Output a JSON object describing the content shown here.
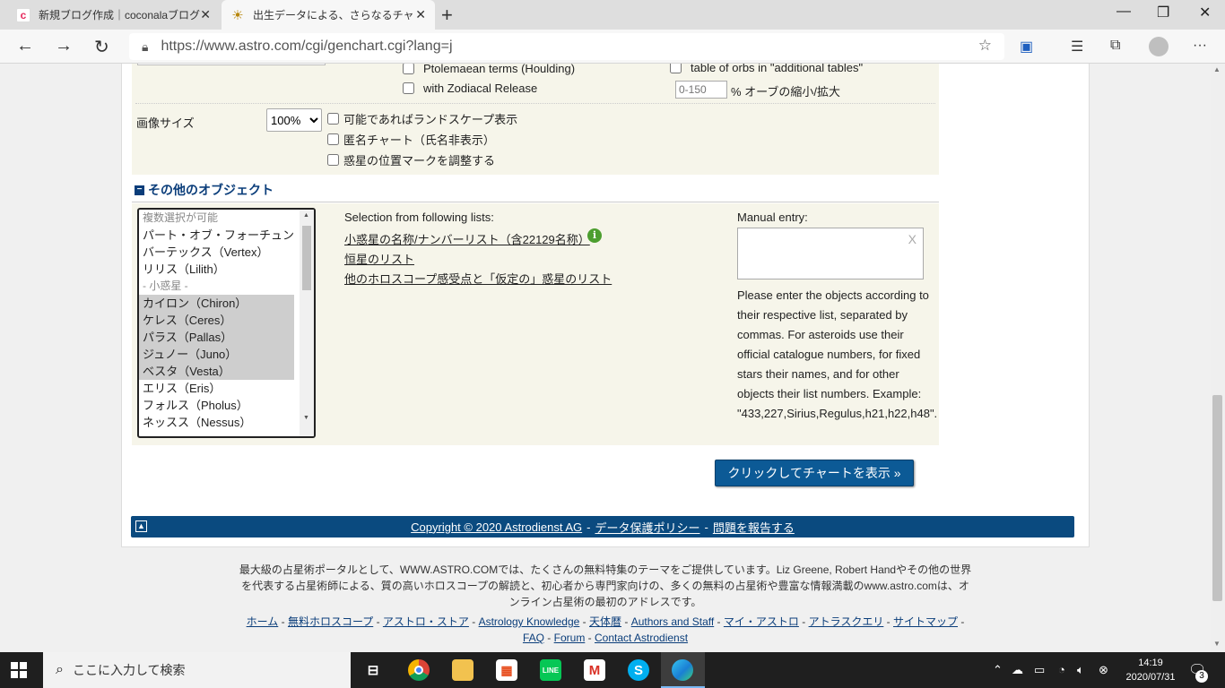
{
  "browser": {
    "tabs": [
      {
        "title": "新規ブログ作成｜coconalaブログ",
        "favicon_letter": "c"
      },
      {
        "title": "出生データによる、さらなるチャート選択",
        "favicon_glyph": "☀"
      }
    ],
    "url": "https://www.astro.com/cgi/genchart.cgi?lang=j"
  },
  "options": {
    "ptolemaean_label": "Ptolemaean terms (Houlding)",
    "zodiacal_label": "with Zodiacal Release",
    "orbs_table_label": "table of orbs in \"additional tables\"",
    "orb_placeholder": "0-150",
    "orb_suffix": "% オーブの縮小/拡大",
    "image_size_label": "画像サイズ",
    "image_size_value": "100%",
    "landscape_label": "可能であればランドスケープ表示",
    "anonymous_label": "匿名チャート（氏名非表示）",
    "adjust_marks_label": "惑星の位置マークを調整する"
  },
  "other_objects": {
    "heading": "その他のオブジェクト",
    "list_items": [
      {
        "label": "複数選択が可能",
        "type": "group"
      },
      {
        "label": "パート・オブ・フォーチュン",
        "type": "item"
      },
      {
        "label": "バーテックス（Vertex）",
        "type": "item"
      },
      {
        "label": "リリス（Lilith）",
        "type": "item"
      },
      {
        "label": "- 小惑星 -",
        "type": "group"
      },
      {
        "label": "カイロン（Chiron）",
        "type": "selected"
      },
      {
        "label": "ケレス（Ceres）",
        "type": "selected"
      },
      {
        "label": "パラス（Pallas）",
        "type": "selected"
      },
      {
        "label": "ジュノー（Juno）",
        "type": "selected"
      },
      {
        "label": "ベスタ（Vesta）",
        "type": "selected"
      },
      {
        "label": "エリス（Eris）",
        "type": "item"
      },
      {
        "label": "フォルス（Pholus）",
        "type": "item"
      },
      {
        "label": "ネッスス（Nessus）",
        "type": "item"
      }
    ],
    "selection_title": "Selection from following lists:",
    "link_asteroids": "小惑星の名称/ナンバーリスト（含22129名称）",
    "link_fixed_stars": "恒星のリスト",
    "link_other": "他のホロスコープ感受点と「仮定の」惑星のリスト",
    "manual_title": "Manual entry:",
    "manual_clear": "X",
    "manual_help_lines": [
      "Please enter the objects according to",
      "their respective list, separated by",
      "commas. For asteroids use their",
      "official catalogue numbers, for fixed",
      "stars their names, and for other",
      "objects their list numbers. Example:",
      "\"433,227,Sirius,Regulus,h21,h22,h48\"."
    ]
  },
  "submit_label": "クリックしてチャートを表示 »",
  "footer": {
    "copyright": "Copyright © 2020 Astrodienst AG",
    "privacy": "データ保護ポリシー",
    "report": "問題を報告する",
    "sep": "-"
  },
  "about_lines": [
    "最大級の占星術ポータルとして、WWW.ASTRO.COMでは、たくさんの無料特集のテーマをご提供しています。Liz Greene, Robert Handやその他の世界",
    "を代表する占星術師による、質の高いホロスコープの解読と、初心者から専門家向けの、多くの無料の占星術や豊富な情報満載のwww.astro.comは、オ",
    "ンライン占星術の最初のアドレスです。"
  ],
  "footer_links": [
    "ホーム",
    "無料ホロスコープ",
    "アストロ・ストア",
    "Astrology Knowledge",
    "天体暦",
    "Authors and Staff",
    "マイ・アストロ",
    "アトラスクエリ",
    "サイトマップ",
    "FAQ",
    "Forum",
    "Contact Astrodienst"
  ],
  "taskbar": {
    "search_placeholder": "ここに入力して検索",
    "time": "14:19",
    "date": "2020/07/31",
    "notification_count": "3"
  },
  "colors": {
    "accent": "#0c5a96",
    "footer_bar": "#0a4a7f",
    "panel_bg": "#f6f5ea"
  }
}
